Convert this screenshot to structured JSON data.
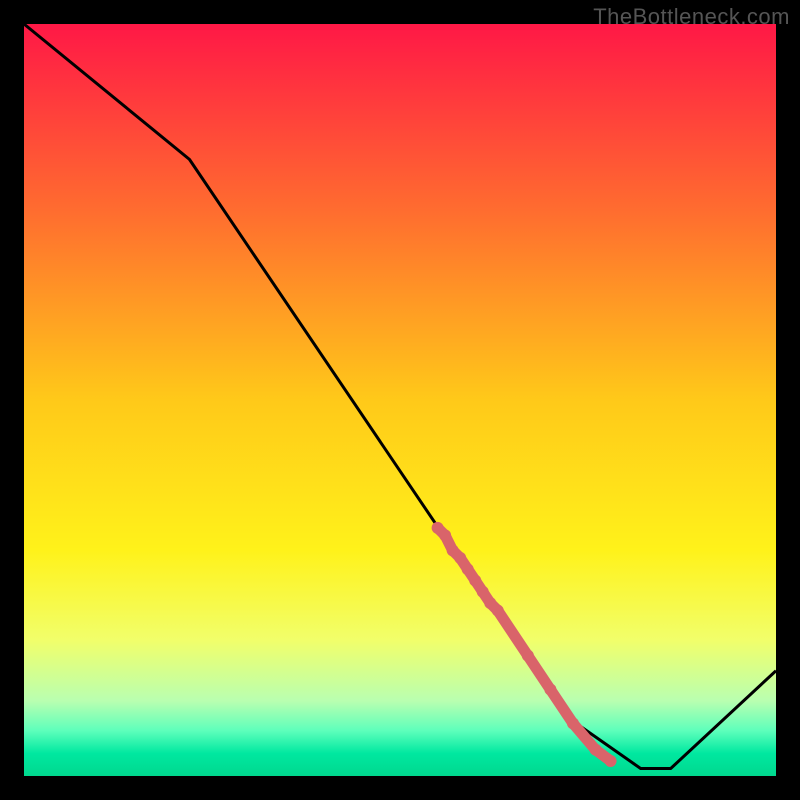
{
  "chart_data": {
    "type": "line",
    "title": "",
    "xlabel": "",
    "ylabel": "",
    "xlim": [
      0,
      100
    ],
    "ylim": [
      0,
      100
    ],
    "x": [
      0,
      22,
      72,
      82,
      86,
      100
    ],
    "values": [
      100,
      82,
      8,
      1,
      1,
      14
    ],
    "series_markers": {
      "x": [
        55,
        56,
        57,
        58,
        59,
        60,
        61,
        62,
        63,
        67,
        70,
        73,
        76,
        78
      ],
      "y": [
        33,
        32,
        30,
        29,
        27.5,
        26,
        24.5,
        23,
        22,
        16,
        11.5,
        7,
        3.5,
        2
      ],
      "color": "#d9646a"
    },
    "background_gradient": {
      "stops": [
        {
          "pos": 0.0,
          "color": "#ff1846"
        },
        {
          "pos": 0.25,
          "color": "#ff6d2f"
        },
        {
          "pos": 0.5,
          "color": "#ffc919"
        },
        {
          "pos": 0.7,
          "color": "#fff21a"
        },
        {
          "pos": 0.82,
          "color": "#f1ff6b"
        },
        {
          "pos": 0.9,
          "color": "#b9ffb0"
        },
        {
          "pos": 0.94,
          "color": "#5dffbb"
        },
        {
          "pos": 0.97,
          "color": "#00e8a0"
        },
        {
          "pos": 1.0,
          "color": "#00d88e"
        }
      ]
    }
  },
  "watermark": "TheBottleneck.com"
}
